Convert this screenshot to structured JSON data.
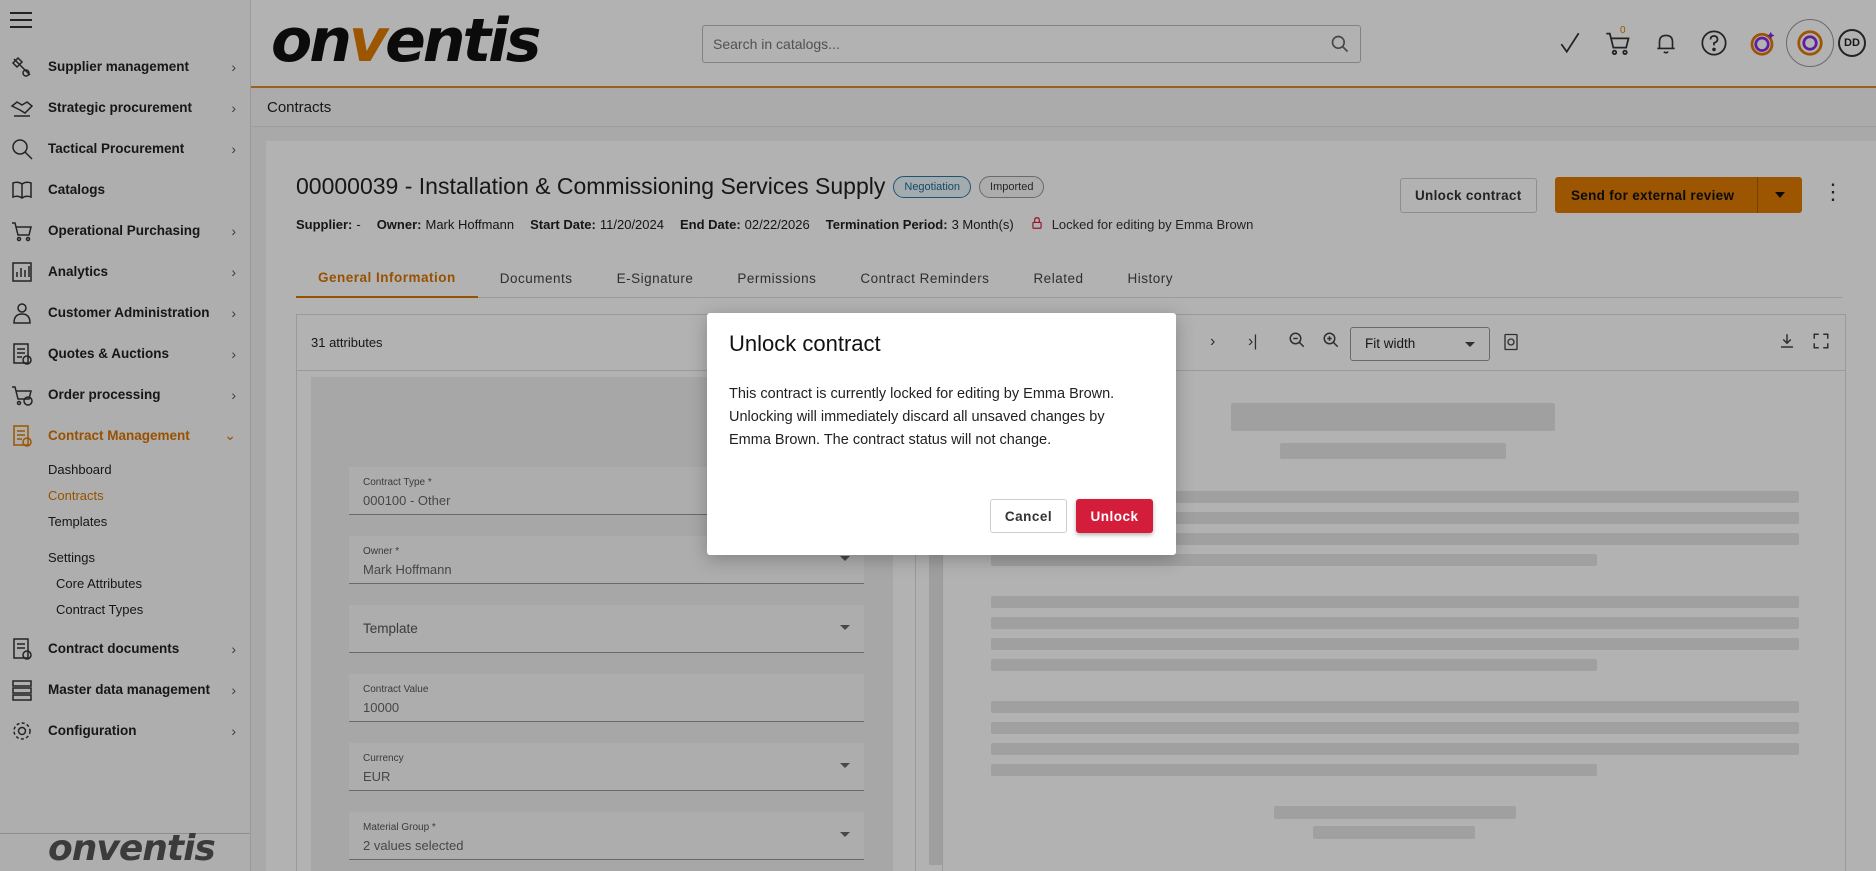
{
  "sidebar": {
    "items": [
      {
        "label": "Supplier management",
        "icon": "supplier-icon",
        "chevron": "›"
      },
      {
        "label": "Strategic procurement",
        "icon": "handshake-icon",
        "chevron": "›"
      },
      {
        "label": "Tactical Procurement",
        "icon": "magnifier-icon",
        "chevron": "›"
      },
      {
        "label": "Catalogs",
        "icon": "book-icon",
        "chevron": ""
      },
      {
        "label": "Operational Purchasing",
        "icon": "cart-icon",
        "chevron": "›"
      },
      {
        "label": "Analytics",
        "icon": "chart-icon",
        "chevron": "›"
      },
      {
        "label": "Customer Administration",
        "icon": "person-icon",
        "chevron": "›"
      },
      {
        "label": "Quotes & Auctions",
        "icon": "document-icon",
        "chevron": "›"
      },
      {
        "label": "Order processing",
        "icon": "cart-clock-icon",
        "chevron": "›"
      },
      {
        "label": "Contract Management",
        "icon": "contract-icon",
        "chevron": "⌄"
      }
    ],
    "contract_sub": {
      "dashboard": "Dashboard",
      "contracts": "Contracts",
      "templates": "Templates",
      "settings": "Settings",
      "core_attributes": "Core Attributes",
      "contract_types": "Contract Types"
    },
    "bottom_items": [
      {
        "label": "Contract documents",
        "chevron": "›"
      },
      {
        "label": "Master data management",
        "chevron": "›"
      },
      {
        "label": "Configuration",
        "chevron": "›"
      }
    ],
    "footer_logo": "onventis"
  },
  "header": {
    "logo_left": "on",
    "logo_v": "v",
    "logo_right": "entis",
    "search_placeholder": "Search in catalogs...",
    "cart_count": "0",
    "avatar_initials": "DD"
  },
  "breadcrumb": "Contracts",
  "contract": {
    "title": "00000039 - Installation & Commissioning Services Supply",
    "status": "Negotiation",
    "tag": "Imported",
    "supplier_label": "Supplier:",
    "supplier": "-",
    "owner_label": "Owner:",
    "owner": "Mark Hoffmann",
    "start_label": "Start Date:",
    "start": "11/20/2024",
    "end_label": "End Date:",
    "end": "02/22/2026",
    "term_label": "Termination Period:",
    "term": "3 Month(s)",
    "lock_text": "Locked for editing by Emma Brown"
  },
  "actions": {
    "unlock": "Unlock contract",
    "send": "Send for external review"
  },
  "tabs": [
    "General Information",
    "Documents",
    "E-Signature",
    "Permissions",
    "Contract Reminders",
    "Related",
    "History"
  ],
  "attributes_count": "31 attributes",
  "fields": {
    "contract_type_label": "Contract Type *",
    "contract_type_value": "000100 - Other",
    "owner_label": "Owner *",
    "owner_value": "Mark Hoffmann",
    "template_label": "Template",
    "value_label": "Contract Value",
    "value_value": "10000",
    "currency_label": "Currency",
    "currency_value": "EUR",
    "material_label": "Material Group *",
    "material_value": "2 values selected"
  },
  "viewer": {
    "zoom_mode": "Fit width"
  },
  "modal": {
    "title": "Unlock contract",
    "body": "This contract is currently locked for editing by Emma Brown. Unlocking will immediately discard all unsaved changes by Emma Brown. The contract status will not change.",
    "cancel": "Cancel",
    "unlock": "Unlock"
  },
  "colors": {
    "accent": "#e07a00",
    "danger": "#d41c3b",
    "status_blue": "#2a7ca8"
  }
}
